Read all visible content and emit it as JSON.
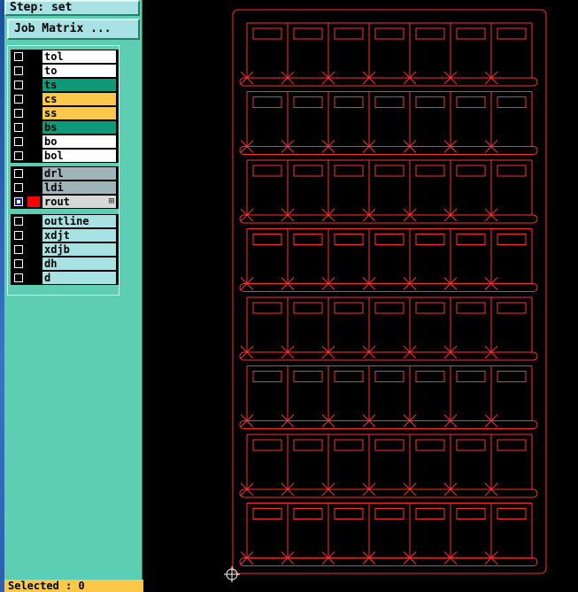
{
  "step_label": "Step: set",
  "job_matrix_label": "Job Matrix ...",
  "selected_text": "Selected : 0",
  "layer_groups": [
    [
      {
        "name": "tol",
        "bg": "#ffffff",
        "checked": false
      },
      {
        "name": "to",
        "bg": "#ffffff",
        "checked": false
      },
      {
        "name": "ts",
        "bg": "#0e9a78",
        "checked": false
      },
      {
        "name": "cs",
        "bg": "#fdc74a",
        "checked": false
      },
      {
        "name": "ss",
        "bg": "#fdc74a",
        "checked": false
      },
      {
        "name": "bs",
        "bg": "#0e9a78",
        "checked": false
      },
      {
        "name": "bo",
        "bg": "#ffffff",
        "checked": false
      },
      {
        "name": "bol",
        "bg": "#ffffff",
        "checked": false
      }
    ],
    [
      {
        "name": "drl",
        "bg": "#9fb4b8",
        "checked": false
      },
      {
        "name": "ldi",
        "bg": "#9fb4b8",
        "checked": false
      },
      {
        "name": "rout",
        "bg": "#d8d8d8",
        "checked": true,
        "swatch": "#ff0000",
        "mark": "⊞"
      }
    ],
    [
      {
        "name": "outline",
        "bg": "#a9e2e4",
        "checked": false
      },
      {
        "name": "xdjt",
        "bg": "#a9e2e4",
        "checked": false
      },
      {
        "name": "xdjb",
        "bg": "#a9e2e4",
        "checked": false
      },
      {
        "name": "dh",
        "bg": "#a9e2e4",
        "checked": false
      },
      {
        "name": "d",
        "bg": "#a9e2e4",
        "checked": false
      }
    ]
  ],
  "colors": {
    "route": "#ff3030",
    "panel": "#5dceb2",
    "canvas": "#000000"
  },
  "board_grid": {
    "rows": 8,
    "columns": 7
  }
}
